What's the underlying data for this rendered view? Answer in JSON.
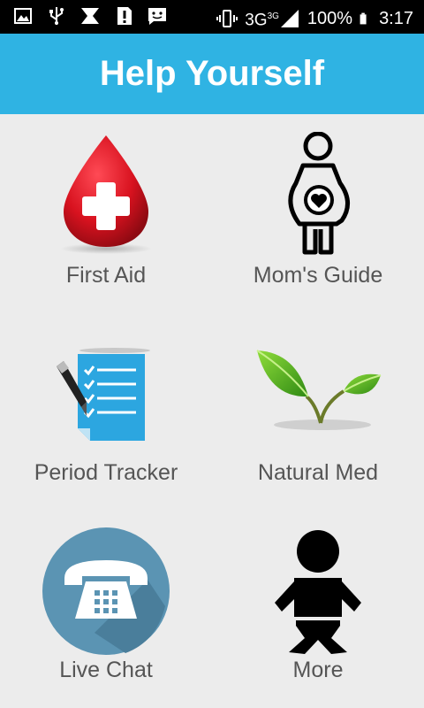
{
  "status_bar": {
    "icons": [
      "image-icon",
      "usb-icon",
      "bowtie-icon",
      "alert-icon",
      "message-icon",
      "vibrate-icon",
      "signal-icon",
      "battery-icon"
    ],
    "network": "3G",
    "network_sup": "3G",
    "battery": "100%",
    "time": "3:17"
  },
  "app_bar": {
    "title": "Help Yourself"
  },
  "tiles": [
    {
      "label": "First Aid",
      "icon": "first-aid-drop-icon"
    },
    {
      "label": "Mom's Guide",
      "icon": "pregnant-woman-icon"
    },
    {
      "label": "Period Tracker",
      "icon": "checklist-pen-icon"
    },
    {
      "label": "Natural Med",
      "icon": "leaves-icon"
    },
    {
      "label": "Live Chat",
      "icon": "telephone-icon"
    },
    {
      "label": "More",
      "icon": "baby-icon"
    }
  ]
}
